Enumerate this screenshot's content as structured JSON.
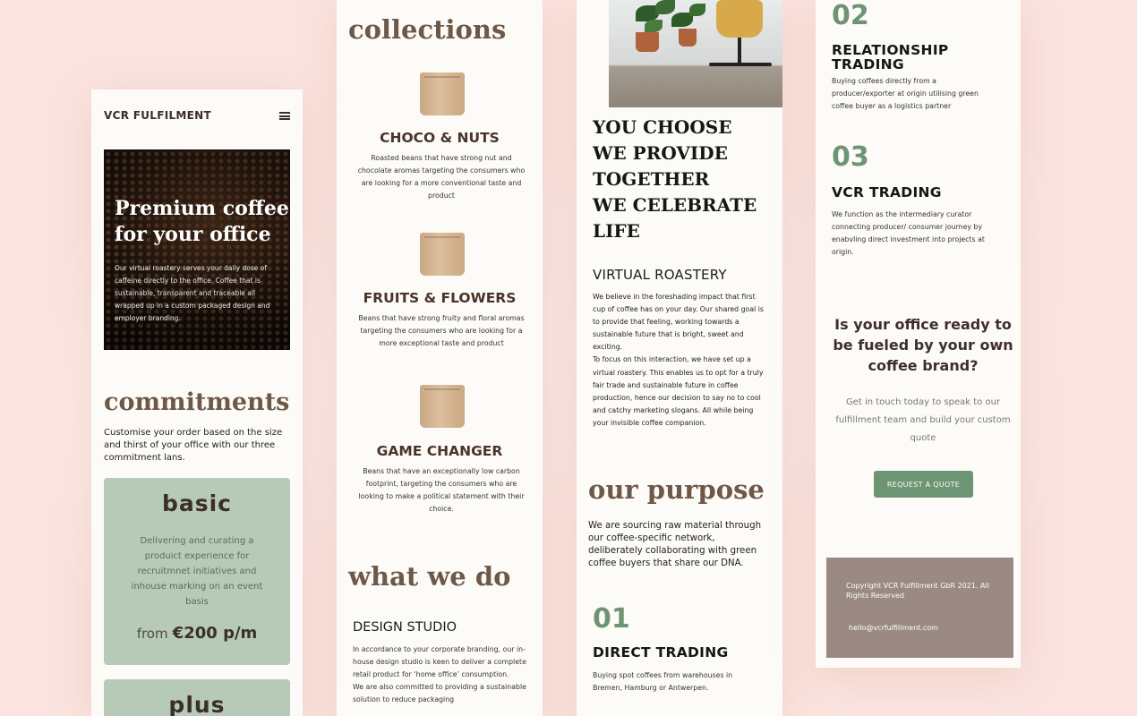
{
  "brand": {
    "name": "VCR FULFILMENT",
    "accent": "#6d9574",
    "heading_brown": "#6e5848",
    "plan_bg": "#b7cab7",
    "footer_bg": "#9a8a83"
  },
  "hero": {
    "title_line1": "Premium coffee",
    "title_line2": "for your office",
    "text": "Our virtual roastery serves your daily dose of caffeine directly to the office. Coffee that is sustainable, transparent and traceable all wrapped up in a custom packaged design and employer branding."
  },
  "commitments": {
    "heading": "commitments",
    "text": "Customise your order based on the size and thirst of your office with our three commitment lans.",
    "plans": [
      {
        "name": "basic",
        "desc": "Delivering and curating a produict experience for recruitmnet initiatives and inhouse marking on an event basis",
        "from": "from",
        "price": "€200 p/m"
      },
      {
        "name": "plus"
      }
    ]
  },
  "collections": {
    "heading": "collections",
    "items": [
      {
        "name": "CHOCO & NUTS",
        "desc": "Roasted beans that have strong nut and chocolate aromas targeting the consumers who are looking for a more conventional taste and product"
      },
      {
        "name": "FRUITS & FLOWERS",
        "desc": "Beans that have strong fruity and floral aromas targeting the consumers who are looking for a more exceptional taste and product"
      },
      {
        "name": "GAME CHANGER",
        "desc": "Beans that have an exceptionally low carbon footprint, targeting the consumers who are looking to make a political statement with their choice."
      }
    ]
  },
  "what_we_do": {
    "heading": "what we do",
    "studio_title": "DESIGN STUDIO",
    "studio_text1": "In accordance to your corporate branding, our in-house design studio is keen to deliver a complete retail product for ‘home office’ consumption.",
    "studio_text2": "We are also committed to providing a sustainable solution to reduce packaging"
  },
  "manifesto": [
    "YOU CHOOSE",
    "WE PROVIDE",
    "TOGETHER",
    "WE CELEBRATE",
    "LIFE"
  ],
  "roastery": {
    "title": "VIRTUAL ROASTERY",
    "text1": "We believe in the foreshading impact that first cup of coffee has on your day. Our shared goal is to provide that feeling, working towards a sustainable future that is bright, sweet and exciting.",
    "text2": "To focus on this interaction, we have set up a virtual roastery. This enables us to opt for a truly fair trade and sustainable future in coffee production, hence our decision to say no to cool and catchy marketing slogans. All while being your invisible coffee companion."
  },
  "purpose": {
    "heading": "our purpose",
    "text": "We are sourcing raw material through our coffee-specific network, deliberately collaborating with green coffee buyers that share our DNA.",
    "items": [
      {
        "num": "01",
        "title": "DIRECT TRADING",
        "text": "Buying spot coffees from warehouses in Bremen, Hamburg or Antwerpen."
      },
      {
        "num": "02",
        "title": "RELATIONSHIP TRADING",
        "text": "Buying coffees directly from a producer/exporter at origin utilising green coffee buyer as a logistics partner"
      },
      {
        "num": "03",
        "title": "VCR TRADING",
        "text": "We function as the intermediary curator connecting producer/ consumer journey by enabvling direct investment into projects at origin."
      }
    ]
  },
  "cta": {
    "heading": "Is your office ready to be fueled by your own coffee brand?",
    "text": "Get in touch today to speak to our fulfillment team and build your custom quote",
    "button": "REQUEST A QUOTE"
  },
  "footer": {
    "copyright": "Copyright VCR Fulfillment GbR 2021. All Rights Reserved",
    "email": "hello@vcrfulfillment.com"
  }
}
